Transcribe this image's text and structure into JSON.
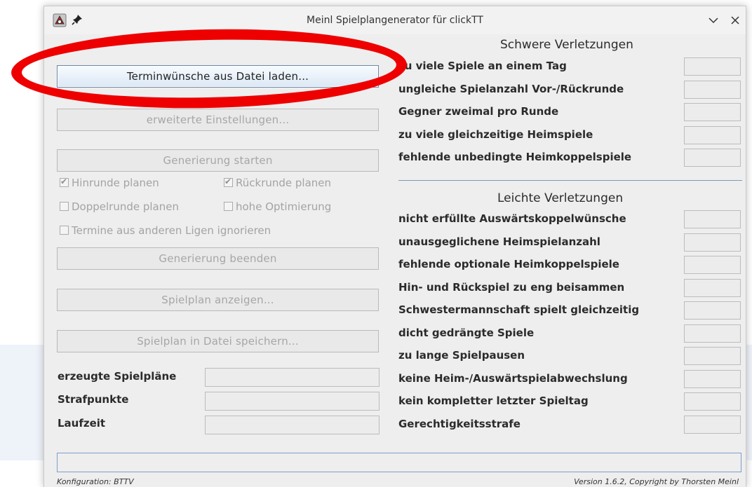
{
  "window": {
    "title": "Meinl Spielplangenerator für clickTT"
  },
  "icons": {
    "app": "app-logo-icon",
    "pin": "pin-icon",
    "minimize": "chevron-down-icon",
    "close": "close-icon"
  },
  "buttons": {
    "load_wishes": "Terminwünsche aus Datei laden...",
    "advanced": "erweiterte Einstellungen...",
    "start": "Generierung starten",
    "stop": "Generierung beenden",
    "show": "Spielplan anzeigen...",
    "save": "Spielplan in Datei speichern..."
  },
  "checkboxes": {
    "hinrunde": {
      "label": "Hinrunde planen",
      "checked": true
    },
    "rueckrunde": {
      "label": "Rückrunde planen",
      "checked": true
    },
    "doppelrunde": {
      "label": "Doppelrunde planen",
      "checked": false
    },
    "hohe_opt": {
      "label": "hohe Optimierung",
      "checked": false
    },
    "ignore": {
      "label": "Termine aus anderen Ligen ignorieren",
      "checked": false
    }
  },
  "stats": {
    "generated": "erzeugte Spielpläne",
    "penalty": "Strafpunkte",
    "runtime": "Laufzeit"
  },
  "severe": {
    "title": "Schwere Verletzungen",
    "items": [
      "zu viele Spiele an einem Tag",
      "ungleiche Spielanzahl Vor-/Rückrunde",
      "Gegner zweimal pro Runde",
      "zu viele gleichzeitige Heimspiele",
      "fehlende unbedingte Heimkoppelspiele"
    ]
  },
  "light": {
    "title": "Leichte Verletzungen",
    "items": [
      "nicht erfüllte Auswärtskoppelwünsche",
      "unausgeglichene Heimspielanzahl",
      "fehlende optionale Heimkoppelspiele",
      "Hin- und Rückspiel zu eng beisammen",
      "Schwestermannschaft spielt gleichzeitig",
      "dicht gedrängte Spiele",
      "zu lange Spielpausen",
      "keine Heim-/Auswärtspielabwechslung",
      "kein kompletter letzter Spieltag",
      "Gerechtigkeitsstrafe"
    ]
  },
  "footer": {
    "config": "Konfiguration: BTTV",
    "version": "Version 1.6.2, Copyright by Thorsten Meinl"
  },
  "colors": {
    "highlight": "#ee0000",
    "accent": "#7d9ec6"
  }
}
